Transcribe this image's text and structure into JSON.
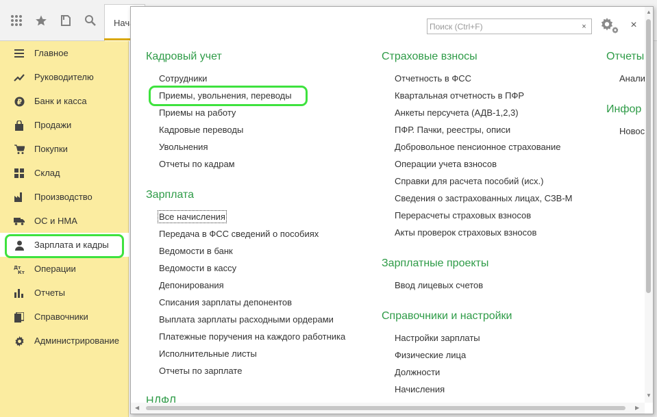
{
  "toolbar": {
    "tab_start_label": "Начальная страница",
    "icons": [
      "apps-grid-icon",
      "star-icon",
      "history-icon",
      "search-icon"
    ]
  },
  "sidebar": {
    "items": [
      {
        "label": "Главное",
        "icon": "menu-lines-icon"
      },
      {
        "label": "Руководителю",
        "icon": "trend-icon"
      },
      {
        "label": "Банк и касса",
        "icon": "ruble-icon"
      },
      {
        "label": "Продажи",
        "icon": "bag-icon"
      },
      {
        "label": "Покупки",
        "icon": "cart-icon"
      },
      {
        "label": "Склад",
        "icon": "warehouse-icon"
      },
      {
        "label": "Производство",
        "icon": "factory-icon"
      },
      {
        "label": "ОС и НМА",
        "icon": "truck-icon"
      },
      {
        "label": "Зарплата и кадры",
        "icon": "person-icon",
        "active": true
      },
      {
        "label": "Операции",
        "icon": "dt-kt-icon"
      },
      {
        "label": "Отчеты",
        "icon": "bar-chart-icon"
      },
      {
        "label": "Справочники",
        "icon": "book-icon"
      },
      {
        "label": "Администрирование",
        "icon": "gear-icon"
      }
    ]
  },
  "panel": {
    "search_placeholder": "Поиск (Ctrl+F)",
    "search_clear": "×",
    "close": "×",
    "columns": [
      {
        "sections": [
          {
            "title": "Кадровый учет",
            "links": [
              "Сотрудники",
              "Приемы, увольнения, переводы",
              "Приемы на работу",
              "Кадровые переводы",
              "Увольнения",
              "Отчеты по кадрам"
            ]
          },
          {
            "title": "Зарплата",
            "links": [
              "Все начисления",
              "Передача в ФСС сведений о пособиях",
              "Ведомости в банк",
              "Ведомости в кассу",
              "Депонирования",
              "Списания зарплаты депонентов",
              "Выплата зарплаты расходными ордерами",
              "Платежные поручения на каждого работника",
              "Исполнительные листы",
              "Отчеты по зарплате"
            ]
          },
          {
            "title": "НДФЛ",
            "links": []
          }
        ]
      },
      {
        "sections": [
          {
            "title": "Страховые взносы",
            "links": [
              "Отчетность в ФСС",
              "Квартальная отчетность в ПФР",
              "Анкеты персучета (АДВ-1,2,3)",
              "ПФР. Пачки, реестры, описи",
              "Добровольное пенсионное страхование",
              "Операции учета взносов",
              "Справки для расчета пособий (исх.)",
              "Сведения о застрахованных лицах, СЗВ-М",
              "Перерасчеты страховых взносов",
              "Акты проверок страховых взносов"
            ]
          },
          {
            "title": "Зарплатные проекты",
            "links": [
              "Ввод лицевых счетов"
            ]
          },
          {
            "title": "Справочники и настройки",
            "links": [
              "Настройки зарплаты",
              "Физические лица",
              "Должности",
              "Начисления"
            ]
          }
        ]
      },
      {
        "sections": [
          {
            "title": "Отчеты",
            "links": [
              "Анали"
            ]
          },
          {
            "title": "Инфор",
            "links": [
              "Новос"
            ]
          }
        ]
      }
    ]
  },
  "colors": {
    "sidebar_bg": "#fbeca0",
    "section_title": "#2e9b47",
    "highlight": "#3ee23e",
    "tab_accent": "#d9a700"
  }
}
